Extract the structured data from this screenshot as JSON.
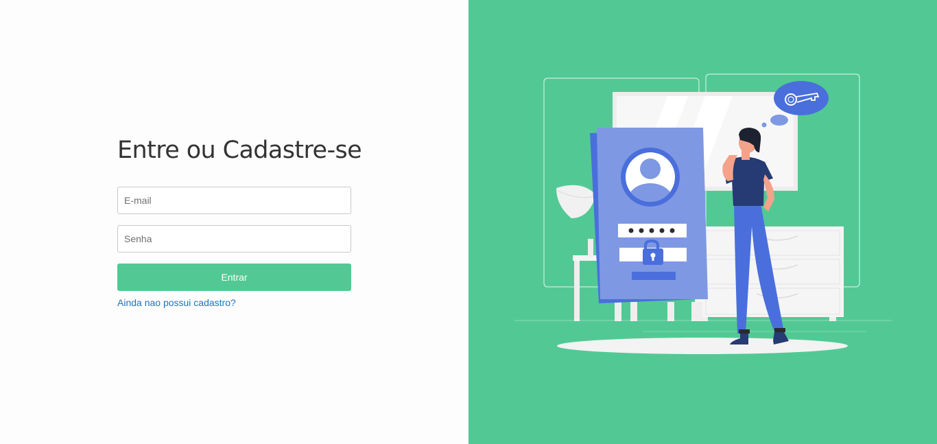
{
  "login": {
    "title": "Entre ou Cadastre-se",
    "email_placeholder": "E-mail",
    "password_placeholder": "Senha",
    "submit_label": "Entrar",
    "signup_link": "Ainda nao possui cadastro?"
  },
  "illustration": {
    "subject": "person-at-login-door",
    "icons": [
      "key-icon",
      "padlock-icon",
      "user-avatar-icon"
    ]
  },
  "colors": {
    "accent": "#52c994",
    "title": "#333333",
    "link": "#1a73c7",
    "illustration_blue": "#4a6fdc",
    "illustration_light_blue": "#7e98e3"
  }
}
